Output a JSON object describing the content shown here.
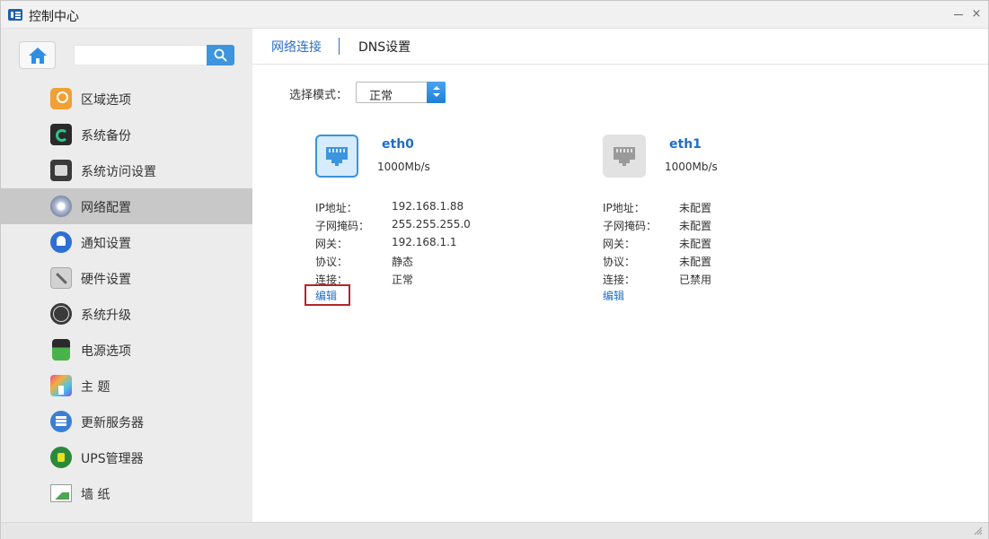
{
  "window": {
    "title": "控制中心",
    "close_glyph": "×"
  },
  "sidebar": {
    "search": {
      "value": "",
      "placeholder": ""
    },
    "items": [
      {
        "label": "区域选项",
        "icon": "region-icon",
        "active": false
      },
      {
        "label": "系统备份",
        "icon": "backup-icon",
        "active": false
      },
      {
        "label": "系统访问设置",
        "icon": "access-icon",
        "active": false
      },
      {
        "label": "网络配置",
        "icon": "network-icon",
        "active": true
      },
      {
        "label": "通知设置",
        "icon": "notification-icon",
        "active": false
      },
      {
        "label": "硬件设置",
        "icon": "hardware-icon",
        "active": false
      },
      {
        "label": "系统升级",
        "icon": "upgrade-icon",
        "active": false
      },
      {
        "label": "电源选项",
        "icon": "power-icon",
        "active": false
      },
      {
        "label": "主 题",
        "icon": "theme-icon",
        "active": false
      },
      {
        "label": "更新服务器",
        "icon": "update-server-icon",
        "active": false
      },
      {
        "label": "UPS管理器",
        "icon": "ups-icon",
        "active": false
      },
      {
        "label": "墙 纸",
        "icon": "wallpaper-icon",
        "active": false
      }
    ]
  },
  "tabs": {
    "network": "网络连接",
    "dns": "DNS设置"
  },
  "mode": {
    "label": "选择模式：",
    "value": "正常"
  },
  "ports": [
    {
      "name": "eth0",
      "speed": "1000Mb/s",
      "status": "enabled",
      "rows": [
        {
          "key": "IP地址：",
          "value": "192.168.1.88"
        },
        {
          "key": "子网掩码：",
          "value": "255.255.255.0"
        },
        {
          "key": "网关：",
          "value": "192.168.1.1"
        },
        {
          "key": "协议：",
          "value": "静态"
        },
        {
          "key": "连接：",
          "value": "正常"
        }
      ],
      "edit_label": "编辑"
    },
    {
      "name": "eth1",
      "speed": "1000Mb/s",
      "status": "disabled",
      "rows": [
        {
          "key": "IP地址：",
          "value": "未配置"
        },
        {
          "key": "子网掩码：",
          "value": "未配置"
        },
        {
          "key": "网关：",
          "value": "未配置"
        },
        {
          "key": "协议：",
          "value": "未配置"
        },
        {
          "key": "连接：",
          "value": "已禁用"
        }
      ],
      "edit_label": "编辑"
    }
  ],
  "colors": {
    "accent": "#2a70c9",
    "active_item": "#c8c8c8",
    "highlight_border": "#b3262a"
  }
}
